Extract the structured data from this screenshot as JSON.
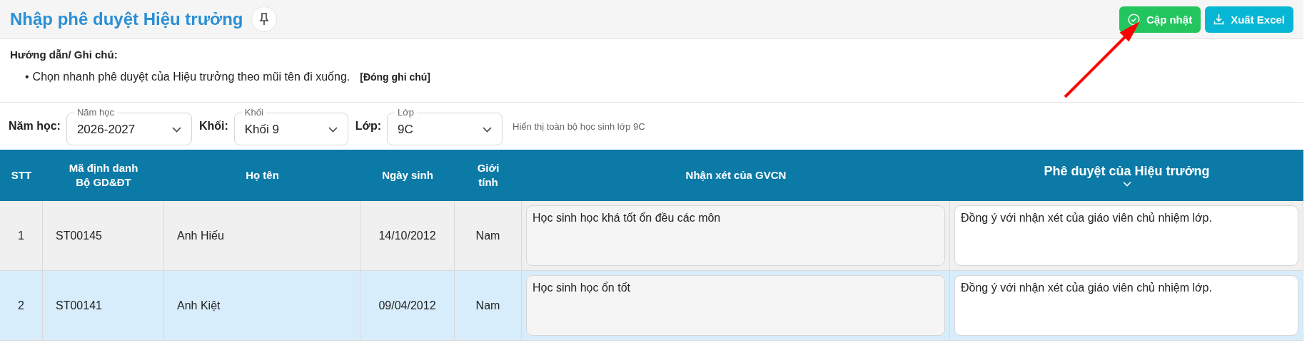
{
  "page": {
    "title": "Nhập phê duyệt Hiệu trưởng"
  },
  "toolbar": {
    "buttons": [
      {
        "label": "Cập nhật",
        "kind": "update"
      },
      {
        "label": "Xuất Excel",
        "kind": "export"
      }
    ]
  },
  "notes": {
    "heading": "Hướng dẫn/ Ghi chú:",
    "items": [
      {
        "bullet": "•",
        "text": "Chọn nhanh phê duyệt của Hiệu trưởng theo mũi tên đi xuống."
      }
    ],
    "close_link": "[Đóng ghi chú]"
  },
  "filters": {
    "fields": [
      {
        "label": "Năm học:",
        "floating_label": "Năm học",
        "value": "2026-2027"
      },
      {
        "label": "Khối:",
        "floating_label": "Khối",
        "value": "Khối 9"
      },
      {
        "label": "Lớp:",
        "floating_label": "Lớp",
        "value": "9C"
      }
    ],
    "hint": "Hiển thị toàn bộ học sinh lớp 9C"
  },
  "table": {
    "columns": [
      {
        "label": "STT",
        "kind": "plain"
      },
      {
        "label": "Mã định danh\nBộ GD&ĐT",
        "kind": "plain"
      },
      {
        "label": "Họ tên",
        "kind": "plain"
      },
      {
        "label": "Ngày sinh",
        "kind": "plain"
      },
      {
        "label": "Giới\ntính",
        "kind": "plain"
      },
      {
        "label": "Nhận xét của GVCN",
        "kind": "plain"
      },
      {
        "label": "Phê duyệt của Hiệu trưởng",
        "kind": "dropdown"
      }
    ],
    "rows": [
      {
        "stt": "1",
        "student_id": "ST00145",
        "name": "Anh Hiếu",
        "birth_date": "14/10/2012",
        "gender": "Nam",
        "teacher_comment": "Học sinh học khá tốt ổn đều các môn",
        "principal_approval": "Đồng ý với nhận xét của giáo viên chủ nhiệm lớp.",
        "selected": false
      },
      {
        "stt": "2",
        "student_id": "ST00141",
        "name": "Anh Kiệt",
        "birth_date": "09/04/2012",
        "gender": "Nam",
        "teacher_comment": "Học sinh học ổn tốt",
        "principal_approval": "Đồng ý với nhận xét của giáo viên chủ nhiệm lớp.",
        "selected": true
      }
    ]
  }
}
